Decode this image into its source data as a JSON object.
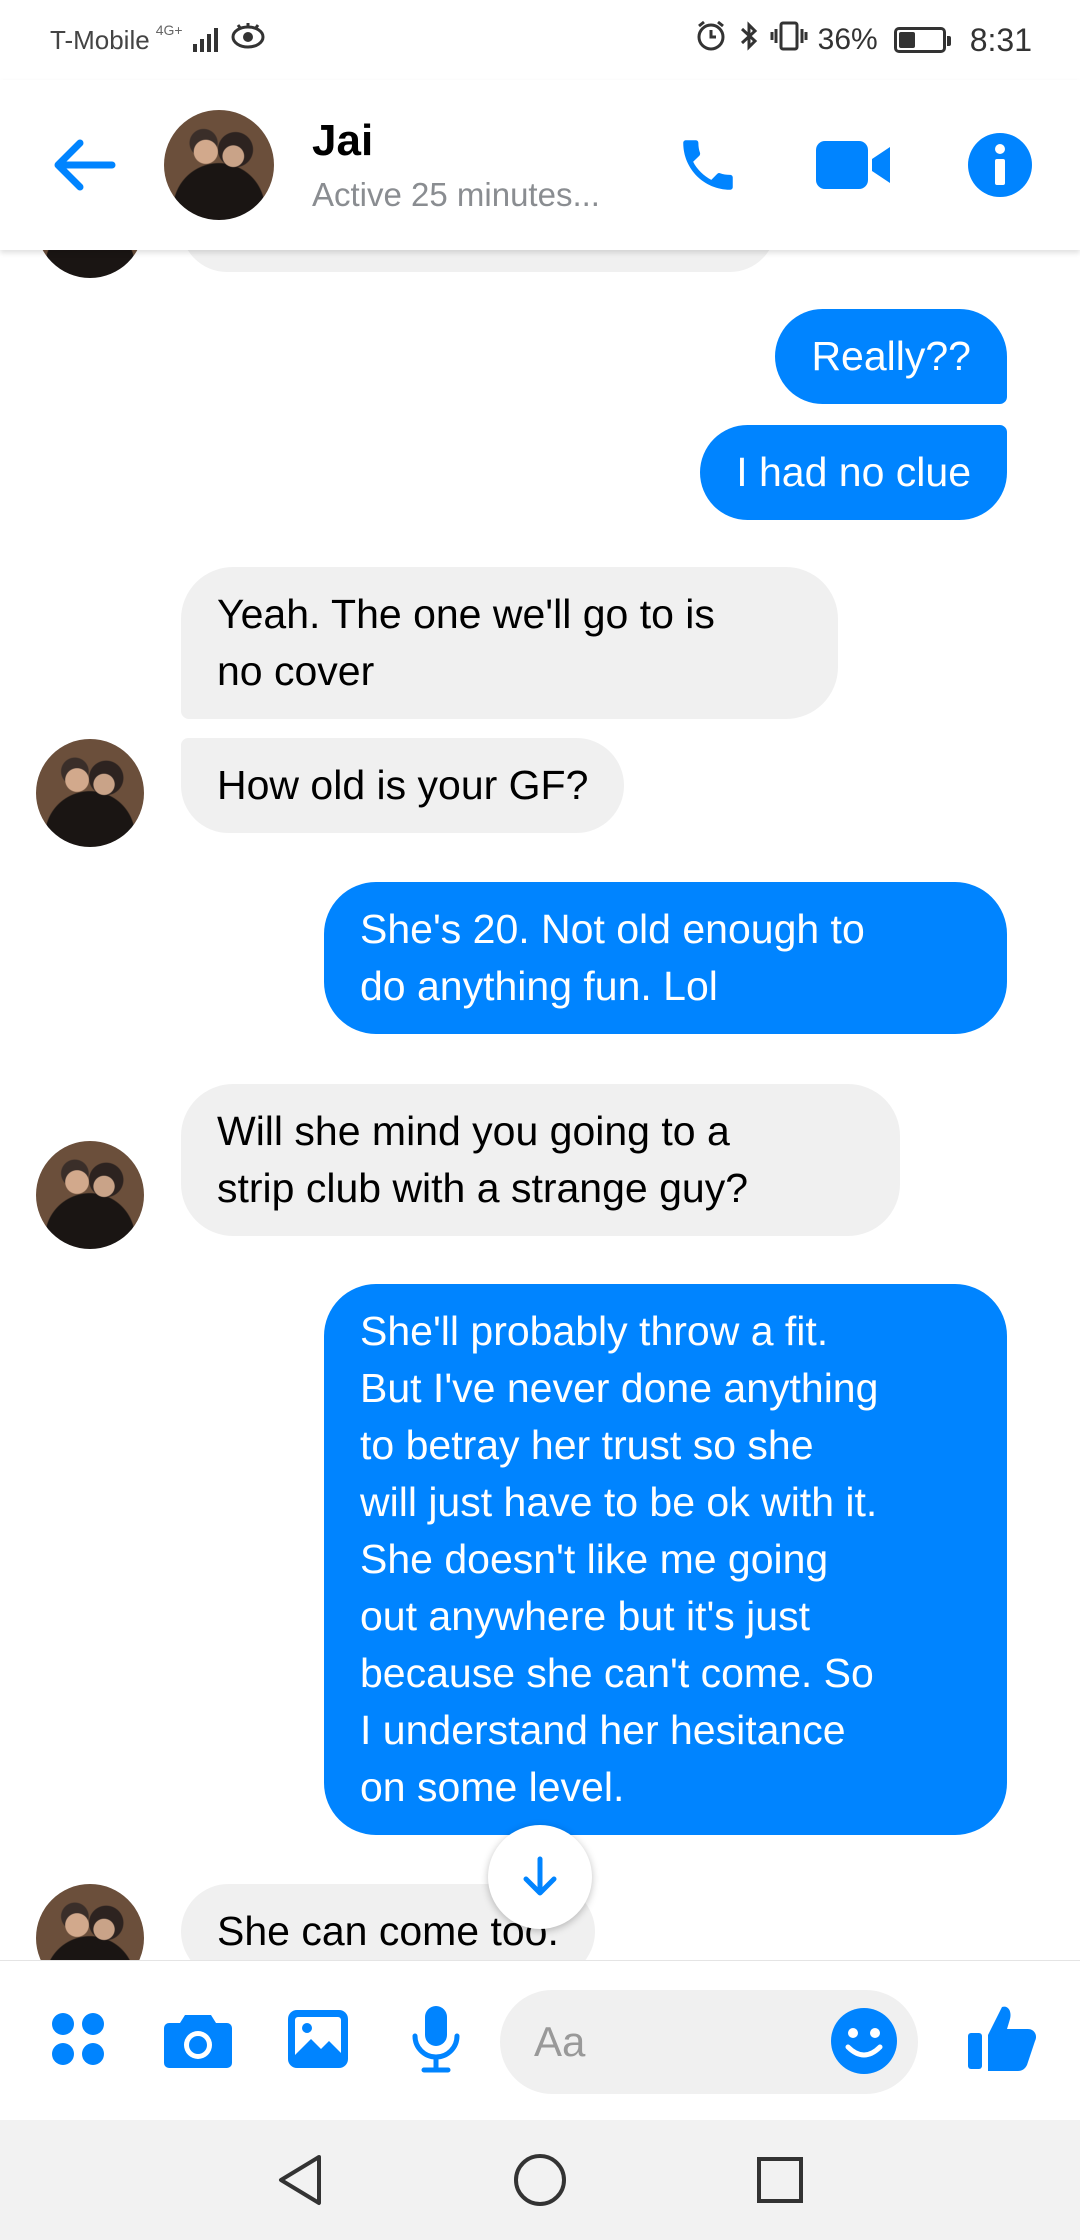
{
  "status_bar": {
    "carrier": "T-Mobile",
    "network": "4G+",
    "battery_text": "36%",
    "battery_level": 0.36,
    "time": "8:31"
  },
  "header": {
    "contact_name": "Jai",
    "contact_status": "Active 25 minutes..."
  },
  "messages": [
    {
      "direction": "out",
      "text": "Really??"
    },
    {
      "direction": "out",
      "text": "I had no clue"
    },
    {
      "direction": "in",
      "text": "Yeah.  The one we'll go to is\nno cover"
    },
    {
      "direction": "in",
      "text": "How old is your GF?"
    },
    {
      "direction": "out",
      "text": "She's 20. Not old enough to\ndo anything fun. Lol"
    },
    {
      "direction": "in",
      "text": "Will she mind you going to a\nstrip club with a strange guy?"
    },
    {
      "direction": "out",
      "text": "She'll probably throw a fit.\nBut I've never done anything\nto betray her trust so she\nwill just have to be ok with it.\nShe doesn't like me going\nout anywhere but it's just\nbecause she can't come. So\nI understand her hesitance\non some level."
    },
    {
      "direction": "in",
      "text": "She can come too."
    }
  ],
  "composer": {
    "placeholder": "Aa"
  },
  "colors": {
    "accent": "#0084ff",
    "incoming_bubble": "#f0f0f0",
    "outgoing_text": "#ffffff"
  },
  "icons": [
    "back-arrow-icon",
    "phone-icon",
    "video-camera-icon",
    "info-icon",
    "apps-grid-icon",
    "camera-icon",
    "gallery-icon",
    "microphone-icon",
    "emoji-icon",
    "thumbs-up-icon",
    "scroll-down-arrow-icon",
    "nav-back-icon",
    "nav-home-icon",
    "nav-recents-icon"
  ]
}
